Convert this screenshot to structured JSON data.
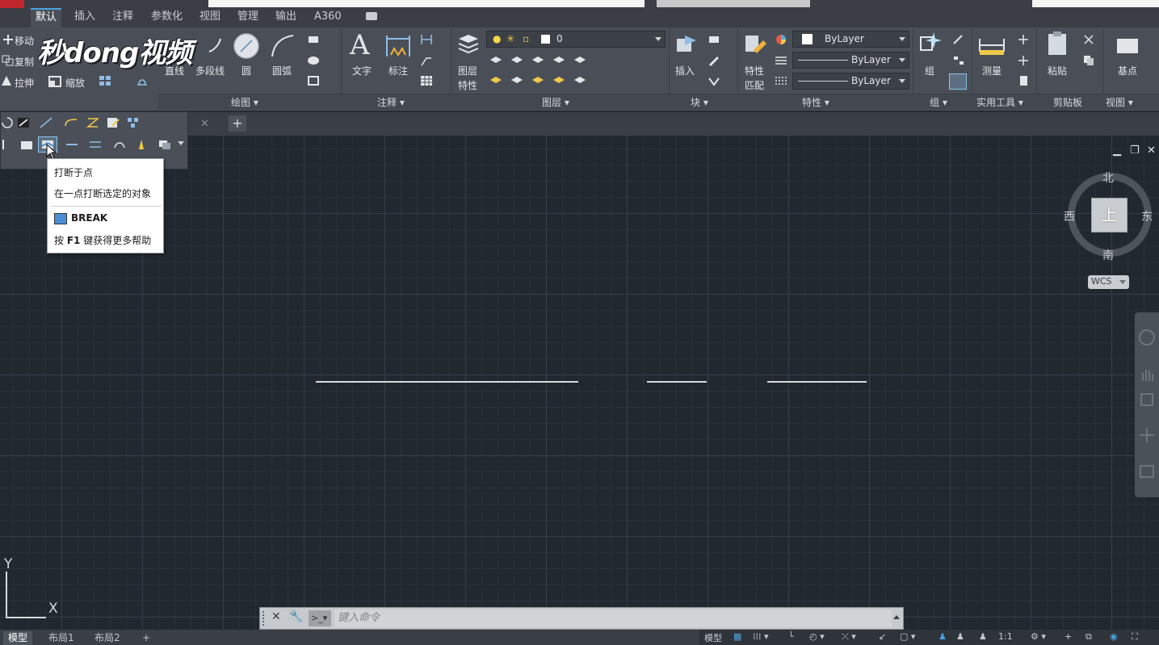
{
  "ribbon": {
    "tabs": [
      "默认",
      "插入",
      "注释",
      "参数化",
      "视图",
      "管理",
      "输出",
      "A360"
    ],
    "active_tab": "默认",
    "modify_small": [
      "移动",
      "复制",
      "拉伸",
      "缩放"
    ],
    "draw_tools": [
      "直线",
      "多段线",
      "圆",
      "圆弧"
    ],
    "annotation_tools": [
      "文字",
      "标注"
    ],
    "layer_tools": [
      "图层",
      "特性"
    ],
    "layer_current": "0",
    "block_tools": [
      "插入"
    ],
    "properties_tools": [
      "特性",
      "匹配"
    ],
    "properties_values": [
      "ByLayer",
      "ByLayer",
      "ByLayer"
    ],
    "group_tool": "组",
    "utilities_tool": "测量",
    "clipboard_tool": "粘贴",
    "view_tool": "基点",
    "panels": [
      "绘图",
      "注释",
      "图层",
      "块",
      "特性",
      "组",
      "实用工具",
      "剪贴板",
      "视图"
    ]
  },
  "watermark": "秒dong视频",
  "tooltip": {
    "title": "打断于点",
    "description": "在一点打断选定的对象",
    "command": "BREAK",
    "help_prefix": "按 ",
    "help_key": "F1",
    "help_suffix": " 键获得更多帮助"
  },
  "viewcube": {
    "north": "北",
    "south": "南",
    "east": "东",
    "west": "西",
    "face": "上",
    "wcs": "WCS"
  },
  "ucs": {
    "x": "X",
    "y": "Y"
  },
  "command_line": {
    "placeholder": "键入命令"
  },
  "status_bar": {
    "layout_tabs": [
      "模型",
      "布局1",
      "布局2"
    ],
    "model_label": "模型",
    "scale": "1:1"
  },
  "colors": {
    "canvas_bg": "#212830",
    "ribbon_bg": "#4a4f57",
    "accent": "#4aa3df",
    "app_logo": "#c0272d"
  }
}
